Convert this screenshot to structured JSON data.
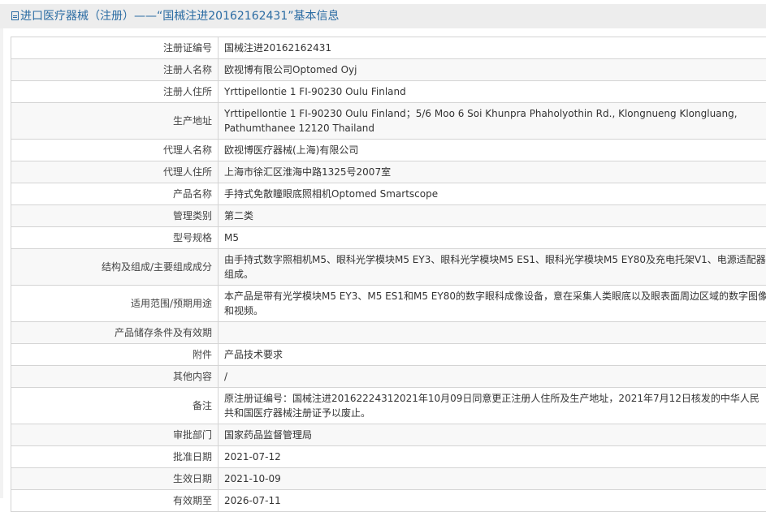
{
  "header": {
    "title": "进口医疗器械（注册）——“国械注进20162162431”基本信息",
    "icon": "document-icon"
  },
  "rows": [
    {
      "label": "注册证编号",
      "value": "国械注进20162162431"
    },
    {
      "label": "注册人名称",
      "value": "欧视博有限公司Optomed Oyj"
    },
    {
      "label": "注册人住所",
      "value": "Yrttipellontie 1 FI-90230 Oulu Finland"
    },
    {
      "label": "生产地址",
      "value": "Yrttipellontie 1 FI-90230 Oulu Finland；5/6 Moo 6 Soi Khunpra Phaholyothin Rd., Klongnueng Klongluang, Pathumthanee 12120 Thailand"
    },
    {
      "label": "代理人名称",
      "value": "欧视博医疗器械(上海)有限公司"
    },
    {
      "label": "代理人住所",
      "value": "上海市徐汇区淮海中路1325号2007室"
    },
    {
      "label": "产品名称",
      "value": "手持式免散瞳眼底照相机Optomed Smartscope"
    },
    {
      "label": "管理类别",
      "value": "第二类"
    },
    {
      "label": "型号规格",
      "value": "M5"
    },
    {
      "label": "结构及组成/主要组成成分",
      "value": "由手持式数字照相机M5、眼科光学模块M5 EY3、眼科光学模块M5 ES1、眼科光学模块M5 EY80及充电托架V1、电源适配器组成。"
    },
    {
      "label": "适用范围/预期用途",
      "value": "本产品是带有光学模块M5 EY3、M5 ES1和M5 EY80的数字眼科成像设备，意在采集人类眼底以及眼表面周边区域的数字图像和视频。"
    },
    {
      "label": "产品储存条件及有效期",
      "value": ""
    },
    {
      "label": "附件",
      "value": "产品技术要求"
    },
    {
      "label": "其他内容",
      "value": "/"
    },
    {
      "label": "备注",
      "value": "原注册证编号：国械注进20162224312021年10月09日同意更正注册人住所及生产地址，2021年7月12日核发的中华人民共和国医疗器械注册证予以废止。"
    },
    {
      "label": "审批部门",
      "value": "国家药品监督管理局"
    },
    {
      "label": "批准日期",
      "value": "2021-07-12"
    },
    {
      "label": "生效日期",
      "value": "2021-10-09"
    },
    {
      "label": "有效期至",
      "value": "2026-07-11"
    }
  ]
}
